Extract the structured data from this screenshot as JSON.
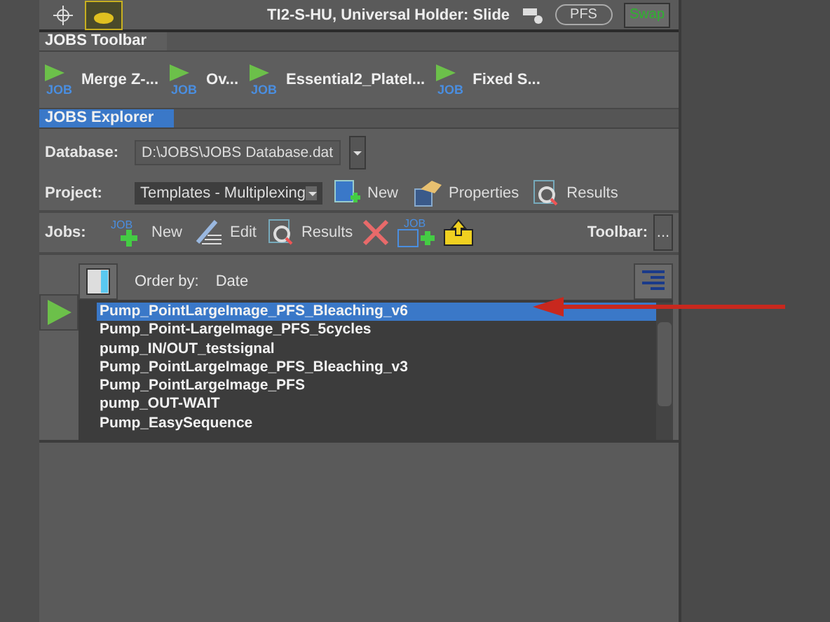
{
  "top_bar": {
    "status": "TI2-S-HU, Universal Holder: Slide",
    "pfs_button": "PFS",
    "swap_button": "Swap"
  },
  "toolbar_panel": {
    "tab": "JOBS Toolbar",
    "jobs": [
      {
        "label": "Merge Z-...",
        "badge": "JOB"
      },
      {
        "label": "Ov...",
        "badge": "JOB"
      },
      {
        "label": "Essential2_PlateI...",
        "badge": "JOB"
      },
      {
        "label": "Fixed S...",
        "badge": "JOB"
      }
    ]
  },
  "explorer": {
    "tab": "JOBS Explorer",
    "database": {
      "label": "Database:",
      "value": "D:\\JOBS\\JOBS Database.dat"
    },
    "project": {
      "label": "Project:",
      "value": "Templates - Multiplexing",
      "actions": [
        {
          "kind": "new",
          "label": "New"
        },
        {
          "kind": "properties",
          "label": "Properties"
        },
        {
          "kind": "results",
          "label": "Results"
        }
      ]
    },
    "jobs_bar": {
      "label": "Jobs:",
      "actions": [
        {
          "kind": "new_job",
          "label": "New",
          "badge": "JOB"
        },
        {
          "kind": "edit",
          "label": "Edit"
        },
        {
          "kind": "results",
          "label": "Results"
        },
        {
          "kind": "delete"
        },
        {
          "kind": "template",
          "badge": "JOB"
        },
        {
          "kind": "export"
        }
      ],
      "toolbar_label": "Toolbar:",
      "more_button": "..."
    },
    "order": {
      "label": "Order by:",
      "value": "Date"
    },
    "job_list": [
      {
        "name": "Pump_PointLargeImage_PFS_Bleaching_v6",
        "selected": true
      },
      {
        "name": "Pump_Point-LargeImage_PFS_5cycles",
        "selected": false
      },
      {
        "name": "pump_IN/OUT_testsignal",
        "selected": false
      },
      {
        "name": "Pump_PointLargeImage_PFS_Bleaching_v3",
        "selected": false
      },
      {
        "name": "Pump_PointLargeImage_PFS",
        "selected": false
      },
      {
        "name": "pump_OUT-WAIT",
        "selected": false
      },
      {
        "name": "Pump_EasySequence",
        "selected": false
      }
    ]
  }
}
